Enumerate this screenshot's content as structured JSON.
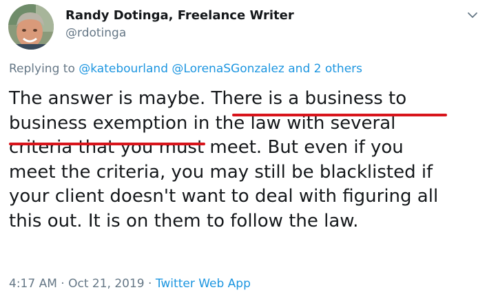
{
  "author": {
    "name": "Randy Dotinga, Freelance Writer",
    "handle": "@rdotinga"
  },
  "reply": {
    "prefix": "Replying to",
    "mentions": [
      "@katebourland",
      "@LorenaSGonzalez"
    ],
    "others": "and 2 others"
  },
  "tweet": {
    "lines": [
      "The answer is maybe. There is a business to",
      "business exemption in the law with several",
      "criteria that you must meet. But even if you",
      "meet the criteria, you may still be blacklisted if",
      "your client doesn't want to deal with figuring all",
      "this out. It is on them to follow the law."
    ],
    "highlighted_phrase": "There is a business to business exemption",
    "highlight_color": "#d8141b"
  },
  "meta": {
    "time": "4:17 AM",
    "separator": "·",
    "date": "Oct 21, 2019",
    "source": "Twitter Web App"
  },
  "colors": {
    "text": "#14171a",
    "secondary": "#657786",
    "link": "#1b95e0"
  },
  "icons": {
    "menu": "chevron-down-icon"
  }
}
